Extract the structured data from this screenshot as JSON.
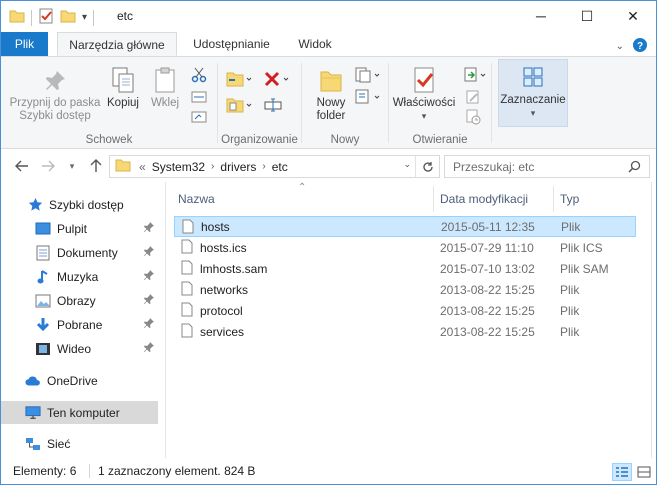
{
  "window": {
    "title": "etc"
  },
  "controls": {
    "minimize": "─",
    "maximize": "☐",
    "close": "✕"
  },
  "ribbon": {
    "tabs": [
      {
        "label": "Plik"
      },
      {
        "label": "Narzędzia główne"
      },
      {
        "label": "Udostępnianie"
      },
      {
        "label": "Widok"
      }
    ],
    "groups": {
      "clipboard": {
        "label": "Schowek",
        "pin": "Przypnij do paska Szybki dostęp",
        "pin_line1": "Przypnij do paska",
        "pin_line2": "Szybki dostęp",
        "copy": "Kopiuj",
        "paste": "Wklej"
      },
      "organize": {
        "label": "Organizowanie"
      },
      "new": {
        "label": "Nowy",
        "new_folder_line1": "Nowy",
        "new_folder_line2": "folder"
      },
      "open": {
        "label": "Otwieranie",
        "properties": "Właściwości"
      },
      "select": {
        "label": "Zaznaczanie"
      }
    }
  },
  "address": {
    "prefix": "«",
    "crumbs": [
      "System32",
      "drivers",
      "etc"
    ],
    "search_placeholder": "Przeszukaj: etc"
  },
  "nav_pane": {
    "quick_access": "Szybki dostęp",
    "items": [
      {
        "label": "Pulpit",
        "icon": "desktop-icon"
      },
      {
        "label": "Dokumenty",
        "icon": "documents-icon"
      },
      {
        "label": "Muzyka",
        "icon": "music-icon"
      },
      {
        "label": "Obrazy",
        "icon": "pictures-icon"
      },
      {
        "label": "Pobrane",
        "icon": "downloads-icon"
      },
      {
        "label": "Wideo",
        "icon": "videos-icon"
      }
    ],
    "onedrive": "OneDrive",
    "this_pc": "Ten komputer",
    "network": "Sieć"
  },
  "file_list": {
    "columns": {
      "name": "Nazwa",
      "date": "Data modyfikacji",
      "type": "Typ"
    },
    "rows": [
      {
        "name": "hosts",
        "date": "2015-05-11 12:35",
        "type": "Plik"
      },
      {
        "name": "hosts.ics",
        "date": "2015-07-29 11:10",
        "type": "Plik ICS"
      },
      {
        "name": "lmhosts.sam",
        "date": "2015-07-10 13:02",
        "type": "Plik SAM"
      },
      {
        "name": "networks",
        "date": "2013-08-22 15:25",
        "type": "Plik"
      },
      {
        "name": "protocol",
        "date": "2013-08-22 15:25",
        "type": "Plik"
      },
      {
        "name": "services",
        "date": "2013-08-22 15:25",
        "type": "Plik"
      }
    ]
  },
  "status": {
    "count": "Elementy: 6",
    "selection": "1 zaznaczony element. 824 B"
  },
  "colors": {
    "file_tab": "#1979ca",
    "selection": "#cce8ff",
    "folder": "#f8d775"
  }
}
